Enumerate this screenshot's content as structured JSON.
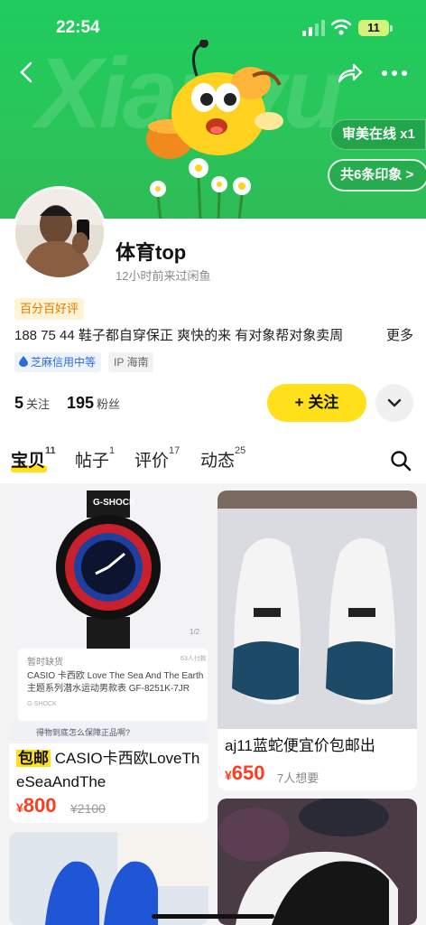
{
  "status_bar": {
    "time": "22:54",
    "battery": "11"
  },
  "header": {
    "bg_text": "Xianyu",
    "online_pill": "审美在线 x1",
    "impressions_pill": "共6条印象 >"
  },
  "profile": {
    "nickname": "体育top",
    "last_seen": "12小时前来过闲鱼",
    "good_tag": "百分百好评",
    "bio": "188 75 44 鞋子都自穿保正 爽快的来 有对象帮对象卖周",
    "bio_more": "更多",
    "credit": "芝麻信用中等",
    "ip": "IP 海南",
    "following_count": "5",
    "following_label": "关注",
    "fans_count": "195",
    "fans_label": "粉丝",
    "follow_button": "+ 关注"
  },
  "tabs": [
    {
      "label": "宝贝",
      "count": "11"
    },
    {
      "label": "帖子",
      "count": "1"
    },
    {
      "label": "评价",
      "count": "17"
    },
    {
      "label": "动态",
      "count": "25"
    }
  ],
  "items": [
    {
      "badge": "包邮",
      "title": "CASIO卡西欧LoveTheSeaAndThe",
      "price_symbol": "¥",
      "price": "800",
      "old_price": "¥2100",
      "inner_status": "暂时缺货",
      "inner_paid": "63人付款",
      "inner_desc": "CASIO 卡西欧 Love The Sea And The Earth 主题系列潜水运动男款表 GF-8251K-7JR",
      "inner_brand": "G-SHOCK",
      "inner_ask": "得物到底怎么保障正品啊?",
      "inner_page": "1/2"
    },
    {
      "title": "aj11蓝蛇便宜价包邮出",
      "price_symbol": "¥",
      "price": "650",
      "want": "7人想要"
    }
  ]
}
